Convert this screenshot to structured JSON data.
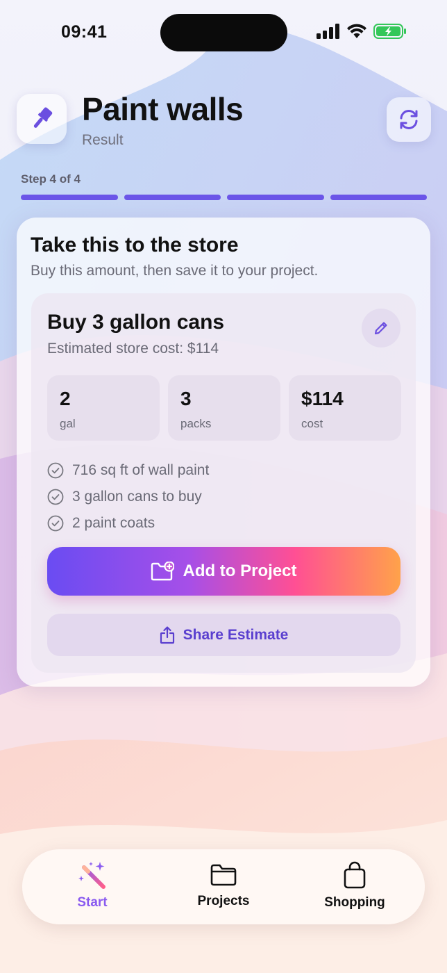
{
  "status_bar": {
    "time": "09:41"
  },
  "header": {
    "title": "Paint walls",
    "subtitle": "Result"
  },
  "progress": {
    "label": "Step 4 of 4",
    "current": 4,
    "total": 4
  },
  "card": {
    "title": "Take this to the store",
    "subtitle": "Buy this amount, then save it to your project."
  },
  "purchase": {
    "title": "Buy 3 gallon cans",
    "estimate": "Estimated store cost: $114",
    "stats": [
      {
        "value": "2",
        "unit": "gal"
      },
      {
        "value": "3",
        "unit": "packs"
      },
      {
        "value": "$114",
        "unit": "cost"
      }
    ],
    "checklist": [
      "716 sq ft of wall paint",
      "3 gallon cans to buy",
      "2 paint coats"
    ],
    "primary_button": "Add to Project",
    "secondary_button": "Share Estimate"
  },
  "tabs": [
    {
      "label": "Start",
      "icon": "magic-wand-icon",
      "active": true
    },
    {
      "label": "Projects",
      "icon": "folder-icon",
      "active": false
    },
    {
      "label": "Shopping",
      "icon": "shopping-bag-icon",
      "active": false
    }
  ],
  "colors": {
    "accent": "#6b55e8",
    "active_tab": "#8a5bf0",
    "gradient_start": "#6a4cf2",
    "gradient_mid": "#ff4f94",
    "gradient_end": "#ffa24a"
  }
}
